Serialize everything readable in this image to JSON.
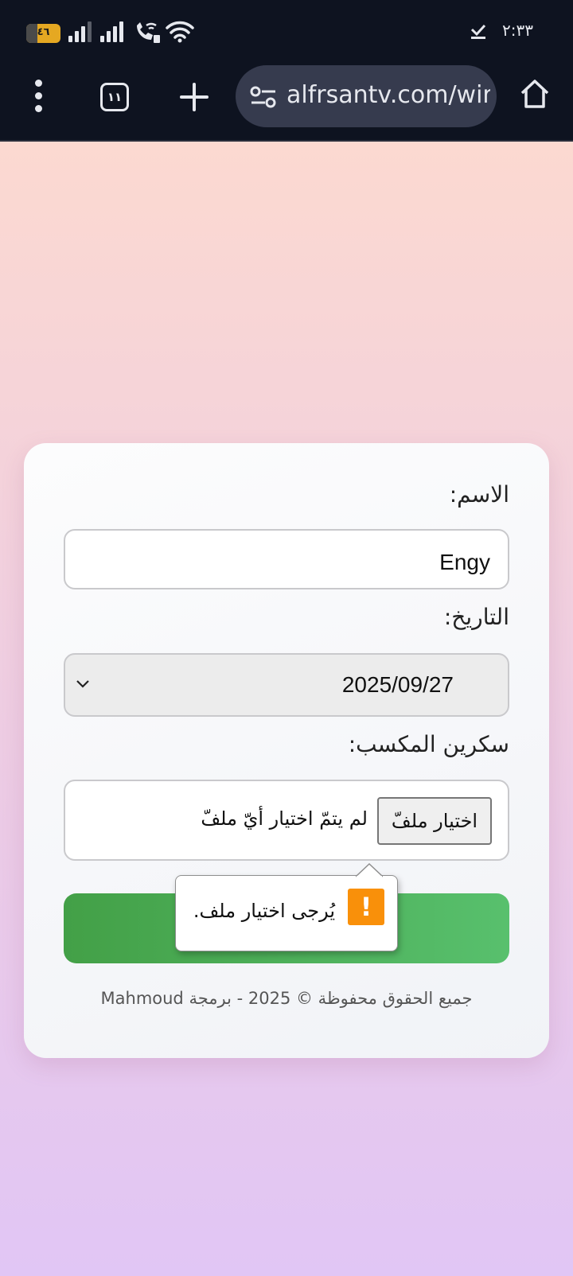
{
  "status_bar": {
    "battery_level": "٤٦",
    "time": "٢:٣٣",
    "icons": [
      "battery-icon",
      "signal-1-icon",
      "signal-2-icon",
      "wifi-calling-icon",
      "wifi-icon",
      "download-done-icon"
    ]
  },
  "browser": {
    "tab_count": "١١",
    "url": "alfrsantv.com/wir",
    "icons": [
      "more-vert-icon",
      "tabs-icon",
      "new-tab-plus-icon",
      "site-settings-icon",
      "home-icon"
    ]
  },
  "form": {
    "name_label": "الاسم:",
    "name_value": "Engy",
    "date_label": "التاريخ:",
    "date_value": "2025/09/27",
    "screen_label": "سكرين المكسب:",
    "file_button": "اختيار ملفّ",
    "file_status": "لم يتمّ اختيار أيّ ملفّ",
    "submit_label": "",
    "footer": "جميع الحقوق محفوظة © 2025 - برمجة Mahmoud"
  },
  "validation": {
    "badge": "!",
    "message": "يُرجى اختيار ملف."
  },
  "colors": {
    "status_bar_bg": "#0e1320",
    "url_bar_bg": "#363b4e",
    "battery": "#e5a822",
    "submit_green": "#4caf50",
    "warning_badge": "#f9900a"
  }
}
